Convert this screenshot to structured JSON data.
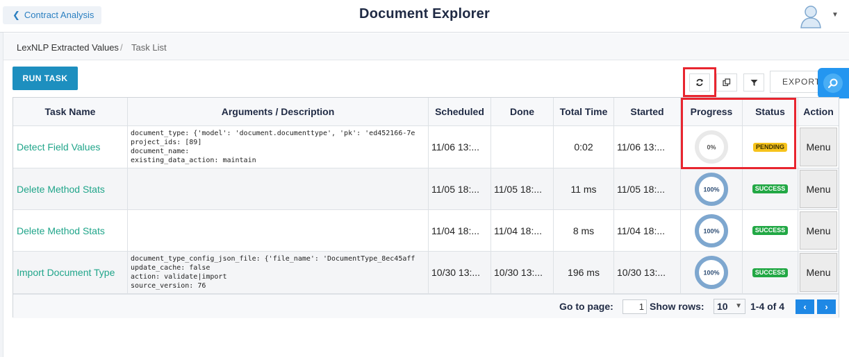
{
  "header": {
    "back_label": "Contract Analysis",
    "title": "Document Explorer"
  },
  "breadcrumb": {
    "items": [
      "LexNLP Extracted Values",
      "Task List"
    ],
    "separator": "/"
  },
  "toolbar": {
    "run_task_label": "RUN TASK",
    "export_label": "EXPORT"
  },
  "table": {
    "columns": [
      "Task Name",
      "Arguments / Description",
      "Scheduled",
      "Done",
      "Total Time",
      "Started",
      "Progress",
      "Status",
      "Action"
    ],
    "rows": [
      {
        "task_name": "Detect Field Values",
        "args": "document_type: {'model': 'document.documenttype', 'pk': 'ed452166-7e\nproject_ids: [89]\ndocument_name:\nexisting_data_action: maintain",
        "scheduled": "11/06 13:...",
        "done": "",
        "total_time": "0:02",
        "started": "11/06 13:...",
        "progress_label": "0%",
        "progress": 0,
        "status": "PENDING",
        "action": "Menu"
      },
      {
        "task_name": "Delete Method Stats",
        "args": "",
        "scheduled": "11/05 18:...",
        "done": "11/05 18:...",
        "total_time": "11 ms",
        "started": "11/05 18:...",
        "progress_label": "100%",
        "progress": 100,
        "status": "SUCCESS",
        "action": "Menu"
      },
      {
        "task_name": "Delete Method Stats",
        "args": "",
        "scheduled": "11/04 18:...",
        "done": "11/04 18:...",
        "total_time": "8 ms",
        "started": "11/04 18:...",
        "progress_label": "100%",
        "progress": 100,
        "status": "SUCCESS",
        "action": "Menu"
      },
      {
        "task_name": "Import Document Type",
        "args": "document_type_config_json_file: {'file_name': 'DocumentType_8ec45aff\nupdate_cache: false\naction: validate|import\nsource_version: 76",
        "scheduled": "10/30 13:...",
        "done": "10/30 13:...",
        "total_time": "196 ms",
        "started": "10/30 13:...",
        "progress_label": "100%",
        "progress": 100,
        "status": "SUCCESS",
        "action": "Menu"
      }
    ]
  },
  "pagination": {
    "goto_label": "Go to page:",
    "page_value": "1",
    "show_rows_label": "Show rows:",
    "rows_value": "10",
    "range_label": "1-4 of 4",
    "prev_label": "‹",
    "next_label": "›"
  },
  "colors": {
    "accent": "#1d8fbf",
    "link": "#20a58a",
    "pending": "#f6c31c",
    "success": "#22a845",
    "highlight": "#e8252f"
  }
}
